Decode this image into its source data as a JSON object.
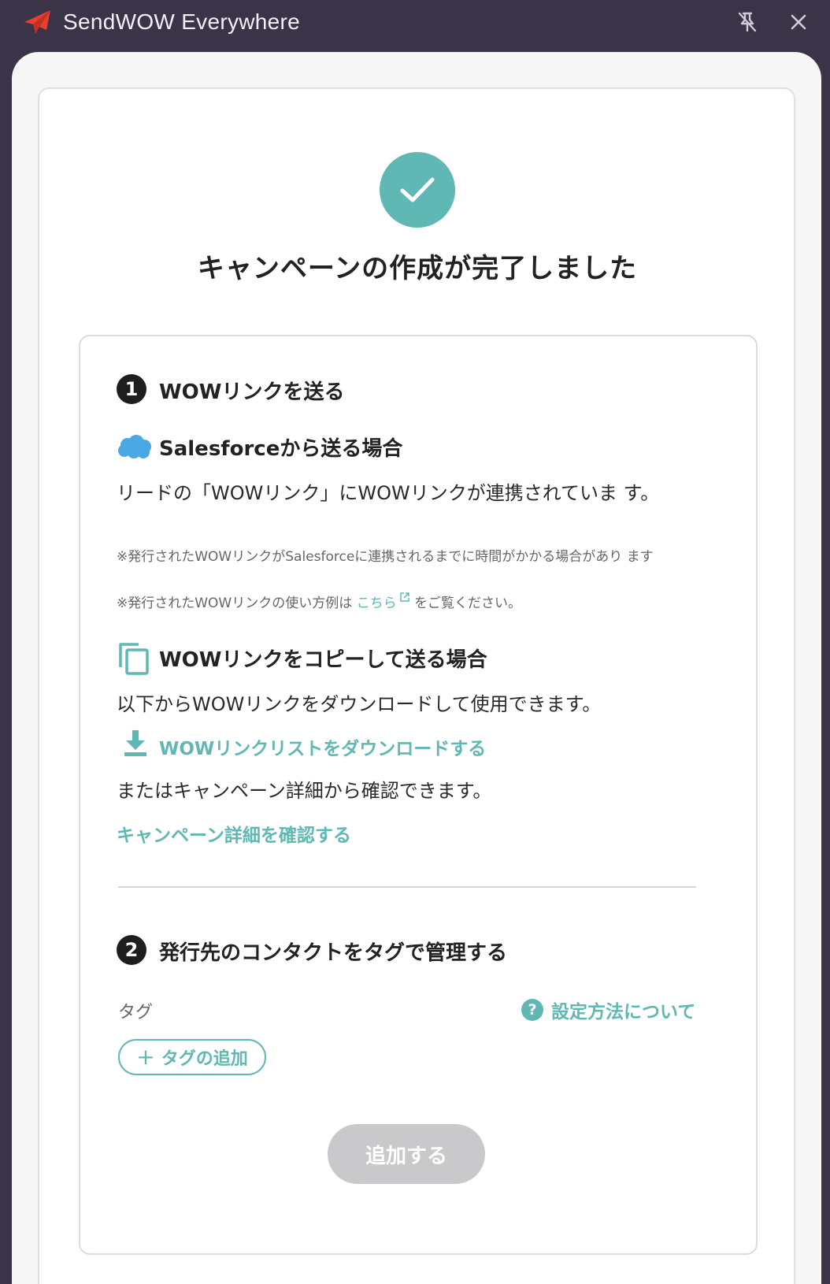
{
  "app": {
    "title": "SendWOW Everywhere",
    "icons": {
      "logo": "paper-plane-icon",
      "pin": "unpin-icon",
      "close": "close-icon"
    }
  },
  "colors": {
    "accent": "#5fb8b3",
    "titlebar": "#3b3448",
    "disabled": "#c9c9cb",
    "logo": "#e8402e"
  },
  "main": {
    "heading": "キャンペーンの作成が完了しました",
    "step1": {
      "number": "1",
      "title": "WOWリンクを送る",
      "salesforce": {
        "title": "Salesforceから送る場合",
        "body": "リードの「WOWリンク」にWOWリンクが連携されていま す。",
        "note1": "※発行されたWOWリンクがSalesforceに連携されるまでに時間がかかる場合があり ます",
        "note2_prefix": "※発行されたWOWリンクの使い方例は",
        "note2_link": "こちら",
        "note2_suffix": "をご覧ください。"
      },
      "copy": {
        "title": "WOWリンクをコピーして送る場合",
        "body1": "以下からWOWリンクをダウンロードして使用できます。",
        "download_link": "WOWリンクリストをダウンロードする",
        "body2": "またはキャンペーン詳細から確認できます。",
        "detail_link": "キャンペーン詳細を確認する"
      }
    },
    "step2": {
      "number": "2",
      "title": "発行先のコンタクトをタグで管理する",
      "tag_label": "タグ",
      "help_link": "設定方法について",
      "help_icon_text": "?",
      "add_tag_plus": "+",
      "add_tag_label": "タグの追加",
      "submit_label": "追加する"
    }
  }
}
